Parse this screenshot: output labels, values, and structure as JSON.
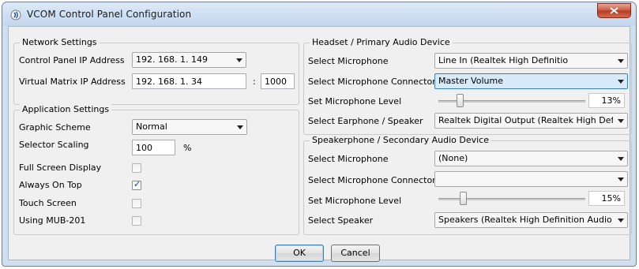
{
  "window": {
    "title": "VCOM Control Panel Configuration",
    "icon": "vcom-app-icon",
    "close_icon": "close-icon"
  },
  "network": {
    "legend": "Network Settings",
    "ip_label": "Control Panel IP Address",
    "ip_value": "192. 168. 1. 149",
    "matrix_label": "Virtual Matrix IP Address",
    "matrix_ip": "192. 168. 1. 34",
    "port_sep": ":",
    "port": "1000"
  },
  "app": {
    "legend": "Application Settings",
    "scheme_label": "Graphic Scheme",
    "scheme_value": "Normal",
    "scaling_label": "Selector Scaling",
    "scaling_value": "100",
    "scaling_unit": "%",
    "fullscreen_label": "Full Screen Display",
    "fullscreen_checked": false,
    "ontop_label": "Always On Top",
    "ontop_checked": true,
    "touch_label": "Touch Screen",
    "touch_checked": false,
    "mub_label": "Using MUB-201",
    "mub_checked": false
  },
  "headset": {
    "legend": "Headset / Primary Audio Device",
    "mic_label": "Select Microphone",
    "mic_value": "Line In (Realtek High Definitio",
    "connector_label": "Select Microphone Connector",
    "connector_value": "Master Volume",
    "level_label": "Set Microphone Level",
    "level_value": 13,
    "level_text": "13%",
    "earphone_label": "Select Earphone / Speaker",
    "earphone_value": "Realtek Digital Output (Realtek High Definition A"
  },
  "speakerphone": {
    "legend": "Speakerphone / Secondary Audio Device",
    "mic_label": "Select Microphone",
    "mic_value": "(None)",
    "connector_label": "Select Microphone Connector",
    "connector_value": "",
    "level_label": "Set Microphone Level",
    "level_value": 15,
    "level_text": "15%",
    "speaker_label": "Select Speaker",
    "speaker_value": "Speakers (Realtek High Definition Audio)"
  },
  "buttons": {
    "ok": "OK",
    "cancel": "Cancel"
  },
  "colors": {
    "titlebar": "#c4d7ee",
    "close": "#c8553d",
    "focus": "#3c7fb1"
  }
}
